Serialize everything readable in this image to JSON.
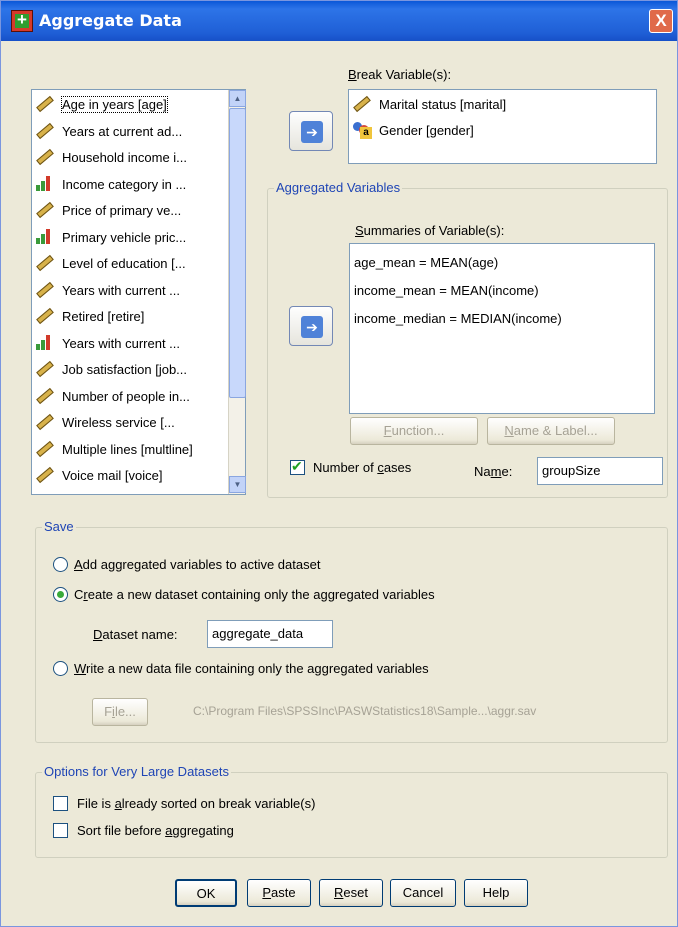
{
  "window": {
    "title": "Aggregate Data",
    "close_label": "X"
  },
  "variables": [
    {
      "label": "Age in years [age]",
      "icon": "ruler-icon",
      "selected": true
    },
    {
      "label": "Years at current ad...",
      "icon": "ruler-icon"
    },
    {
      "label": "Household income i...",
      "icon": "ruler-icon"
    },
    {
      "label": "Income category in ...",
      "icon": "bar-chart-icon"
    },
    {
      "label": "Price of primary ve...",
      "icon": "ruler-icon"
    },
    {
      "label": "Primary vehicle pric...",
      "icon": "bar-chart-icon"
    },
    {
      "label": "Level of education [...",
      "icon": "ruler-icon"
    },
    {
      "label": "Years with current ...",
      "icon": "ruler-icon"
    },
    {
      "label": "Retired [retire]",
      "icon": "ruler-icon"
    },
    {
      "label": "Years with current ...",
      "icon": "bar-chart-icon"
    },
    {
      "label": "Job satisfaction [job...",
      "icon": "ruler-icon"
    },
    {
      "label": "Number of people in...",
      "icon": "ruler-icon"
    },
    {
      "label": "Wireless service [...",
      "icon": "ruler-icon"
    },
    {
      "label": "Multiple lines [multline]",
      "icon": "ruler-icon"
    },
    {
      "label": "Voice mail [voice]",
      "icon": "ruler-icon"
    }
  ],
  "break": {
    "label_pre": "",
    "label_u": "B",
    "label_post": "reak Variable(s):",
    "items": [
      {
        "label": "Marital status [marital]",
        "icon": "ruler-icon"
      },
      {
        "label": "Gender [gender]",
        "icon": "person-nominal-icon"
      }
    ]
  },
  "aggregated": {
    "title": "Aggregated Variables",
    "summaries_pre": "",
    "summaries_u": "S",
    "summaries_post": "ummaries of Variable(s):",
    "items": [
      "age_mean = MEAN(age)",
      "income_mean = MEAN(income)",
      "income_median = MEDIAN(income)"
    ],
    "function_pre": "",
    "function_u": "F",
    "function_post": "unction...",
    "namelabel_pre": "",
    "namelabel_u": "N",
    "namelabel_post": "ame & Label...",
    "cases_pre": "Number of ",
    "cases_u": "c",
    "cases_post": "ases",
    "cases_checked": true,
    "name_pre": "Na",
    "name_u": "m",
    "name_post": "e:",
    "name_value": "groupSize"
  },
  "save": {
    "title": "Save",
    "opt1_pre": "",
    "opt1_u": "A",
    "opt1_post": "dd aggregated variables to active dataset",
    "opt2_pre": "C",
    "opt2_u": "r",
    "opt2_post": "eate a new dataset containing only the aggregated variables",
    "dataset_pre": "",
    "dataset_u": "D",
    "dataset_post": "ataset name:",
    "dataset_value": "aggregate_data",
    "opt3_pre": "",
    "opt3_u": "W",
    "opt3_post": "rite a new data file containing only the aggregated variables",
    "file_pre": "F",
    "file_u": "i",
    "file_post": "le...",
    "path": "C:\\Program Files\\SPSSInc\\PASWStatistics18\\Sample...\\aggr.sav",
    "selected": 2
  },
  "options": {
    "title": "Options for Very Large Datasets",
    "opt1_pre": "File is ",
    "opt1_u": "a",
    "opt1_post": "lready sorted on break variable(s)",
    "opt2_pre": "Sort file before ",
    "opt2_u": "a",
    "opt2_post": "ggregating"
  },
  "buttons": {
    "ok": "OK",
    "paste_pre": "",
    "paste_u": "P",
    "paste_post": "aste",
    "reset_pre": "",
    "reset_u": "R",
    "reset_post": "eset",
    "cancel": "Cancel",
    "help": "Help"
  }
}
